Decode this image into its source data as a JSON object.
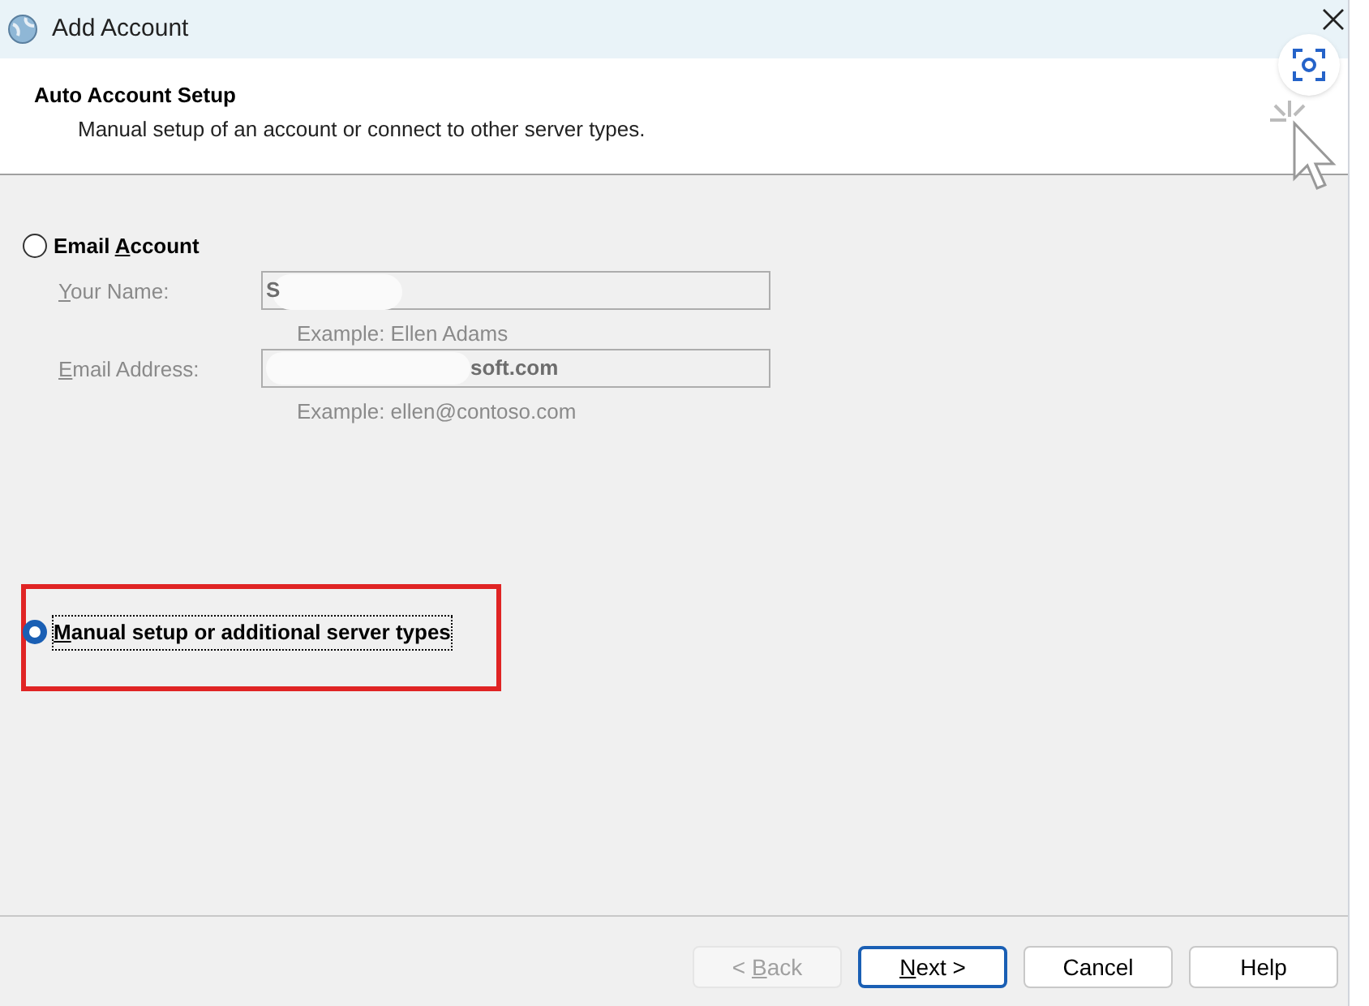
{
  "window": {
    "title": "Add Account"
  },
  "header": {
    "title": "Auto Account Setup",
    "subtitle": "Manual setup of an account or connect to other server types."
  },
  "options": [
    {
      "kind": "email",
      "parts": [
        {
          "text": "Email "
        },
        {
          "text": "A",
          "underlined": true
        },
        {
          "text": "ccount"
        }
      ],
      "selected": false,
      "disabled": true,
      "fields": [
        {
          "parts": [
            {
              "text": "Y",
              "underlined": true
            },
            {
              "text": "our Name:"
            }
          ],
          "value": "S",
          "blurred": true,
          "example": "Example: Ellen Adams"
        },
        {
          "parts": [
            {
              "text": "E",
              "underlined": true
            },
            {
              "text": "mail Address:"
            }
          ],
          "value": "soft.com",
          "blurred": true,
          "example": "Example: ellen@contoso.com"
        }
      ]
    },
    {
      "kind": "manual",
      "parts": [
        {
          "text": "M",
          "underlined": true
        },
        {
          "text": "anual setup or additional server types"
        }
      ],
      "selected": true,
      "focused": true,
      "highlighted": true
    }
  ],
  "buttons": [
    {
      "parts": [
        {
          "text": "< "
        },
        {
          "text": "B",
          "underlined": true
        },
        {
          "text": "ack"
        }
      ],
      "disabled": true,
      "default": false
    },
    {
      "parts": [
        {
          "text": "N",
          "underlined": true
        },
        {
          "text": "ext >"
        }
      ],
      "disabled": false,
      "default": true
    },
    {
      "parts": [
        {
          "text": "Cancel"
        }
      ],
      "disabled": false,
      "default": false
    },
    {
      "parts": [
        {
          "text": "Help"
        }
      ],
      "disabled": false,
      "default": false
    }
  ]
}
